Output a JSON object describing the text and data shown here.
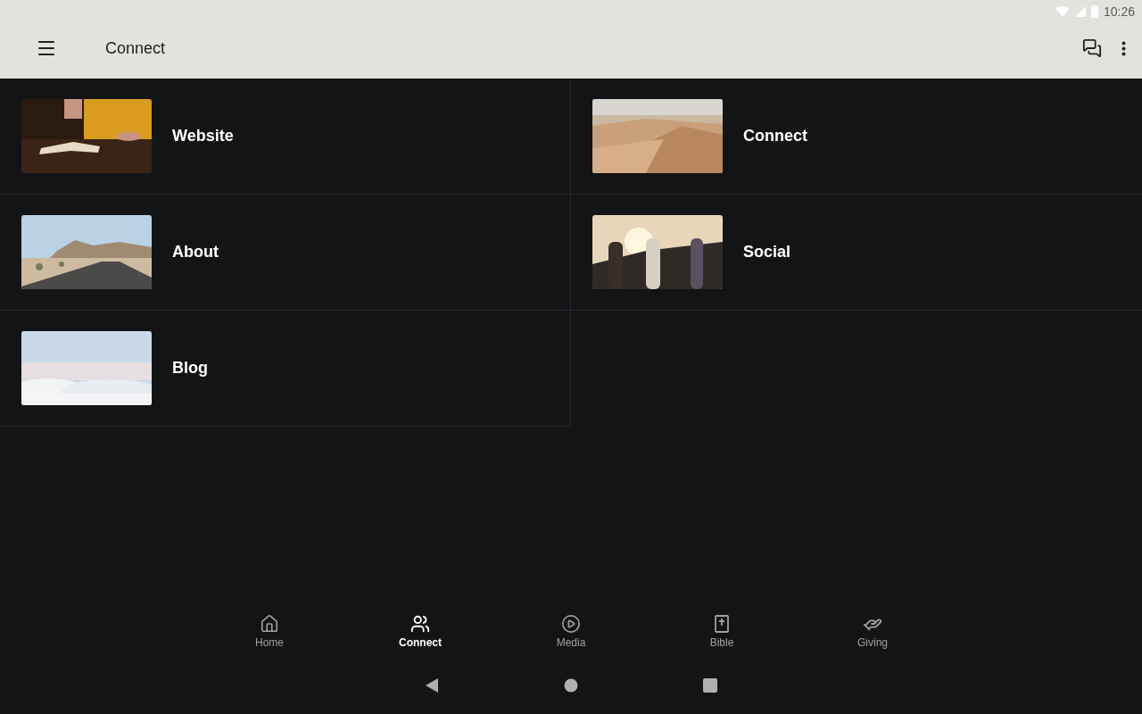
{
  "status_bar": {
    "time": "10:26"
  },
  "app_bar": {
    "title": "Connect"
  },
  "tiles": [
    {
      "label": "Website",
      "kind": "picture"
    },
    {
      "label": "Connect",
      "kind": "picture"
    },
    {
      "label": "About",
      "kind": "picture"
    },
    {
      "label": "Social",
      "kind": "picture"
    },
    {
      "label": "Blog",
      "kind": "picture"
    }
  ],
  "bottom_nav": [
    {
      "label": "Home",
      "selected": false
    },
    {
      "label": "Connect",
      "selected": true
    },
    {
      "label": "Media",
      "selected": false
    },
    {
      "label": "Bible",
      "selected": false
    },
    {
      "label": "Giving",
      "selected": false
    }
  ]
}
